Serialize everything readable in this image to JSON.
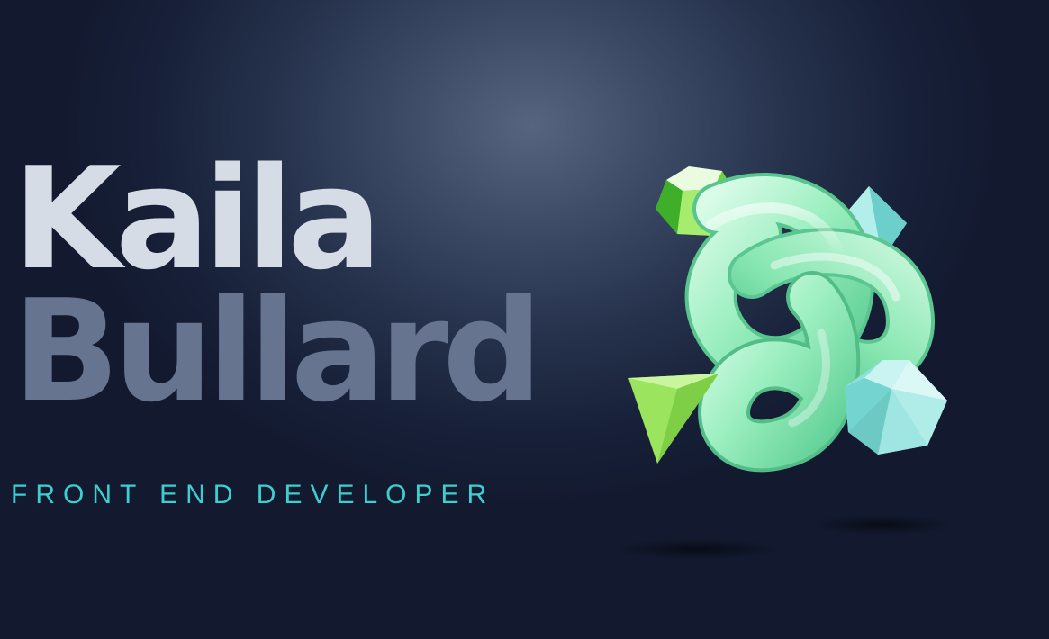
{
  "hero": {
    "first_name": "Kaila",
    "last_name": "Bullard",
    "role": "FRONT END DEVELOPER"
  },
  "colors": {
    "background": "#1b2440",
    "first_name": "#d5dce6",
    "last_name": "#66748f",
    "role": "#3ccfce",
    "knot_green": "#8de8b4",
    "gem_cyan": "#8fe0dc",
    "gem_lime": "#8ed954"
  }
}
